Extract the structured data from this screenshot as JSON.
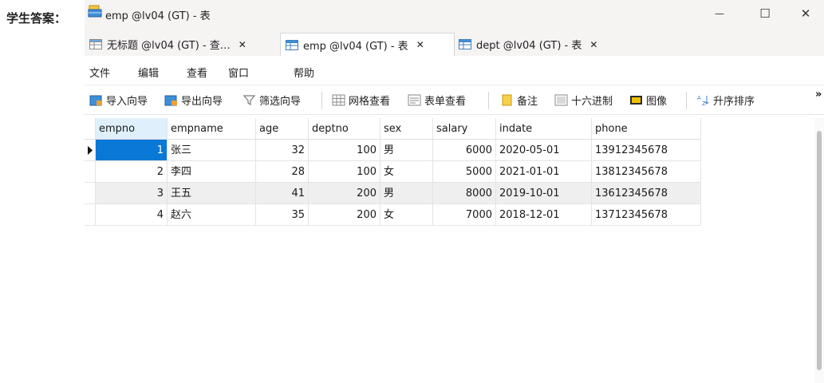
{
  "answer_label": "学生答案：",
  "window": {
    "title": "emp @lv04 (GT) - 表",
    "controls": {
      "minimize": "—",
      "maximize": "☐",
      "close": "✕"
    }
  },
  "tabs": [
    {
      "label": "无标题 @lv04 (GT) - 查…",
      "close": "✕"
    },
    {
      "label": "emp @lv04 (GT) - 表",
      "close": "✕"
    },
    {
      "label": "dept @lv04 (GT) - 表",
      "close": "✕"
    }
  ],
  "menu": [
    "文件",
    "编辑",
    "查看",
    "窗口",
    "帮助"
  ],
  "toolbar": {
    "import_wizard": "导入向导",
    "export_wizard": "导出向导",
    "filter_wizard": "筛选向导",
    "grid_view": "网格查看",
    "form_view": "表单查看",
    "memo": "备注",
    "hex": "十六进制",
    "image": "图像",
    "sort_asc": "升序排序",
    "overflow": "»"
  },
  "table": {
    "columns": [
      "empno",
      "empname",
      "age",
      "deptno",
      "sex",
      "salary",
      "indate",
      "phone"
    ],
    "rows": [
      [
        "1",
        "张三",
        "32",
        "100",
        "男",
        "6000",
        "2020-05-01",
        "13912345678"
      ],
      [
        "2",
        "李四",
        "28",
        "100",
        "女",
        "5000",
        "2021-01-01",
        "13812345678"
      ],
      [
        "3",
        "王五",
        "41",
        "200",
        "男",
        "8000",
        "2019-10-01",
        "13612345678"
      ],
      [
        "4",
        "赵六",
        "35",
        "200",
        "女",
        "7000",
        "2018-12-01",
        "13712345678"
      ]
    ]
  },
  "colors": {
    "selection": "#0a78d7",
    "sorted_header": "#dff0fc",
    "alt_row": "#efefef",
    "titlebar": "#f6f3f3"
  }
}
